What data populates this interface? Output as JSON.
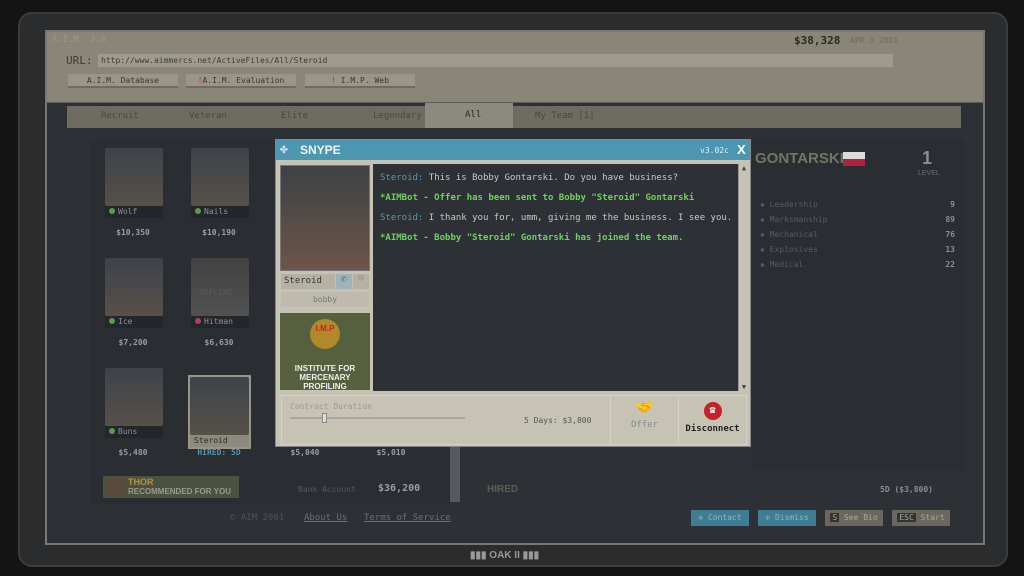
{
  "header": {
    "app_title": "A.I.M. 3.0",
    "balance": "$38,328",
    "date": "APR 3 2001",
    "url_label": "URL:",
    "url": "http://www.aimmercs.net/ActiveFiles/All/Steroid"
  },
  "nav": [
    {
      "label": "A.I.M. Database",
      "alert": ""
    },
    {
      "label": "A.I.M. Evaluation",
      "alert": "!"
    },
    {
      "label": "I.M.P. Web",
      "alert": "!"
    }
  ],
  "tabs": [
    {
      "label": "Recruit"
    },
    {
      "label": "Veteran"
    },
    {
      "label": "Elite"
    },
    {
      "label": "Legendary"
    },
    {
      "label": "All",
      "active": true
    },
    {
      "label": "My Team [1]"
    }
  ],
  "mercs": [
    {
      "name": "Wolf",
      "price": "$10,350",
      "status": "online"
    },
    {
      "name": "Nails",
      "price": "$10,190",
      "status": "online"
    },
    {
      "name": "Ice",
      "price": "$7,200",
      "status": "online"
    },
    {
      "name": "Hitman",
      "price": "$6,630",
      "status": "offline",
      "overlay": "OFFLINE"
    },
    {
      "name": "Buns",
      "price": "$5,480",
      "status": "online"
    },
    {
      "name": "Steroid",
      "price": "HIRED: 5D",
      "status": "hired"
    }
  ],
  "hidden_prices": [
    "$5,040",
    "$5,010"
  ],
  "recommend": {
    "name": "THOR",
    "text": "RECOMMENDED FOR YOU"
  },
  "bank": {
    "label": "Bank Account",
    "value": "$36,200"
  },
  "footer": {
    "copyright": "© AIM 2001",
    "about": "About Us",
    "terms": "Terms of Service"
  },
  "profile": {
    "surname": "GONTARSKI",
    "level": "1",
    "level_label": "LEVEL",
    "stats": [
      {
        "label": "Leadership",
        "value": "9"
      },
      {
        "label": "Marksmanship",
        "value": "89"
      },
      {
        "label": "Mechanical",
        "value": "76"
      },
      {
        "label": "Explosives",
        "value": "13"
      },
      {
        "label": "Medical",
        "value": "22"
      }
    ],
    "hired_label": "HIRED",
    "hired_value": "5D ($3,800)"
  },
  "actions": {
    "contact": "Contact",
    "dismiss": "Dismiss",
    "bio_key": "S",
    "bio": "See Bio",
    "start_key": "ESC",
    "start": "Start"
  },
  "bottom_brand": "OAK II",
  "snype": {
    "title": "SNYPE",
    "version": "v3.02c",
    "close": "X",
    "nick": "Steroid",
    "user": "bobby",
    "imp": {
      "badge": "I.M.P",
      "line1": "INSTITUTE FOR",
      "line2": "MERCENARY PROFILING"
    },
    "messages": [
      {
        "who": "Steroid:",
        "text": "This is Bobby Gontarski. Do you have business?"
      },
      {
        "bot": "*AIMBot - Offer has been sent to Bobby \"Steroid\" Gontarski"
      },
      {
        "who": "Steroid:",
        "text": "I thank you for, umm, giving me the business. I see you."
      },
      {
        "bot": "*AIMBot - Bobby \"Steroid\" Gontarski has joined the team."
      }
    ],
    "contract_label": "Contract Duration",
    "contract_value": "5 Days: $3,800",
    "contract_days": 5,
    "offer": "Offer",
    "disconnect": "Disconnect"
  }
}
